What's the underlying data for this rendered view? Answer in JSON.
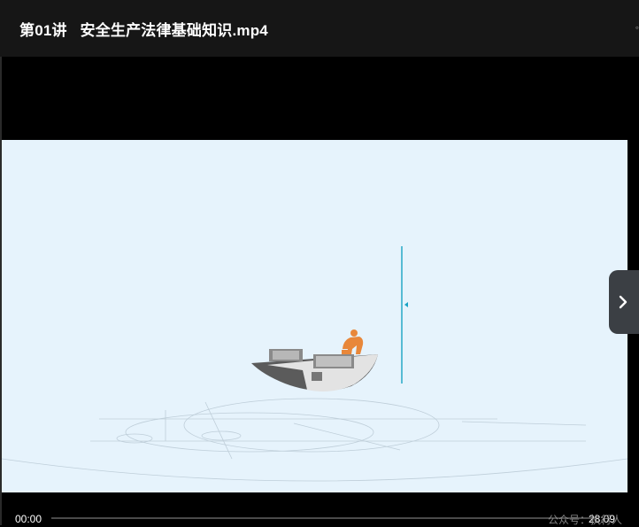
{
  "window": {
    "title": "第01讲   安全生产法律基础知识.mp4"
  },
  "player": {
    "current_time": "00:00",
    "duration": "28:09",
    "progress_fraction": 0.0,
    "next_button_label": "next"
  },
  "watermark": {
    "text": "公众号：执行人"
  },
  "colors": {
    "titlebar_bg": "#161616",
    "video_bg": "#000000",
    "frame_bg": "#e6f3fc",
    "figure_color": "#e8873a",
    "scale_line_color": "#1aa3c4"
  },
  "icons": {
    "next": "chevron-right-icon"
  }
}
